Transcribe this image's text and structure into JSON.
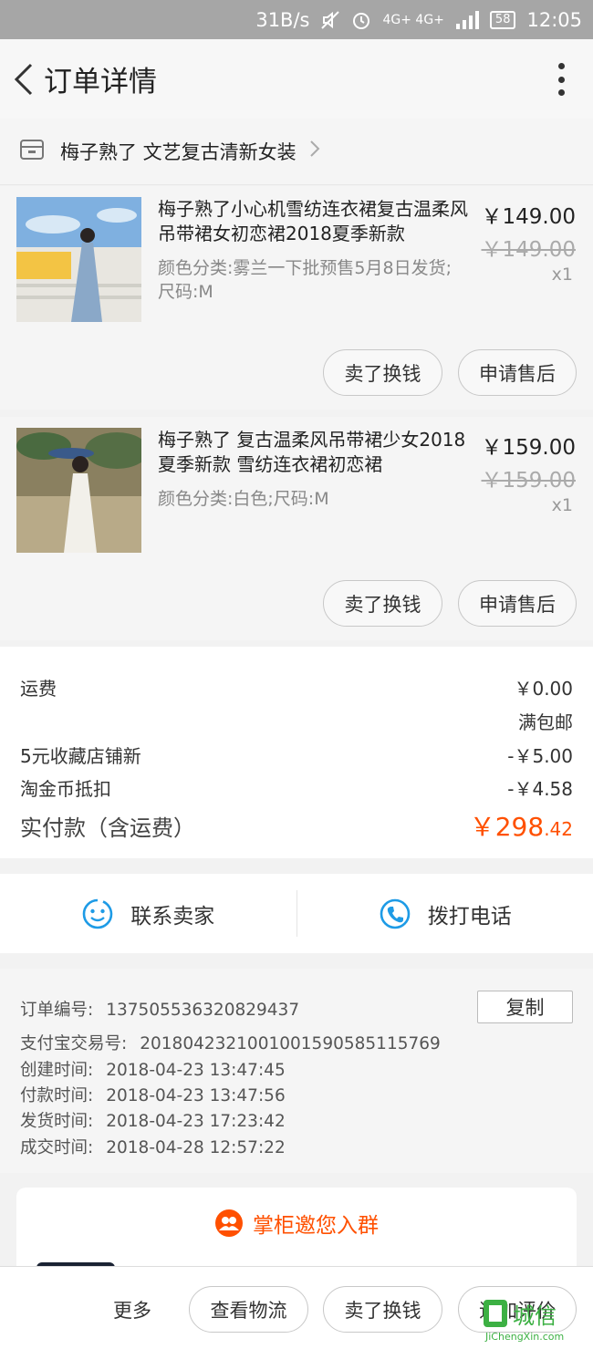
{
  "status_bar": {
    "speed": "31B/s",
    "network": "4G+ 4G+",
    "battery": "58",
    "time": "12:05"
  },
  "header": {
    "title": "订单详情"
  },
  "shop": {
    "name": "梅子熟了 文艺复古清新女装"
  },
  "items": [
    {
      "title": "梅子熟了小心机雪纺连衣裙复古温柔风吊带裙女初恋裙2018夏季新款",
      "spec": "颜色分类:雾兰一下批预售5月8日发货;尺码:M",
      "price": "￥149.00",
      "original_price": "￥149.00",
      "qty": "x1",
      "btn_sell": "卖了换钱",
      "btn_aftersale": "申请售后"
    },
    {
      "title": "梅子熟了 复古温柔风吊带裙少女2018夏季新款 雪纺连衣裙初恋裙",
      "spec": "颜色分类:白色;尺码:M",
      "price": "￥159.00",
      "original_price": "￥159.00",
      "qty": "x1",
      "btn_sell": "卖了换钱",
      "btn_aftersale": "申请售后"
    }
  ],
  "fees": {
    "shipping_label": "运费",
    "shipping_value": "￥0.00",
    "shipping_note": "满包邮",
    "discount1_label": "5元收藏店铺新",
    "discount1_value": "-￥5.00",
    "discount2_label": "淘金币抵扣",
    "discount2_value": "-￥4.58",
    "total_label": "实付款（含运费）",
    "total_symbol": "￥",
    "total_int": "298",
    "total_dec": ".42"
  },
  "contact": {
    "seller": "联系卖家",
    "phone": "拨打电话"
  },
  "order_info": {
    "order_no_label": "订单编号:",
    "order_no": "137505536320829437",
    "copy": "复制",
    "alipay_label": "支付宝交易号:",
    "alipay_no": "2018042321001001590585115769",
    "created_label": "创建时间:",
    "created": "2018-04-23 13:47:45",
    "paid_label": "付款时间:",
    "paid": "2018-04-23 13:47:56",
    "shipped_label": "发货时间:",
    "shipped": "2018-04-23 17:23:42",
    "completed_label": "成交时间:",
    "completed": "2018-04-28 12:57:22"
  },
  "group": {
    "title": "掌柜邀您入群"
  },
  "bottom_bar": {
    "more": "更多",
    "logistics": "查看物流",
    "sell": "卖了换钱",
    "review": "追加评价"
  },
  "watermark": {
    "text": "城信",
    "url": "JiChengXin.com"
  },
  "colors": {
    "accent": "#ff5000",
    "contact_icon": "#1e9be6"
  }
}
